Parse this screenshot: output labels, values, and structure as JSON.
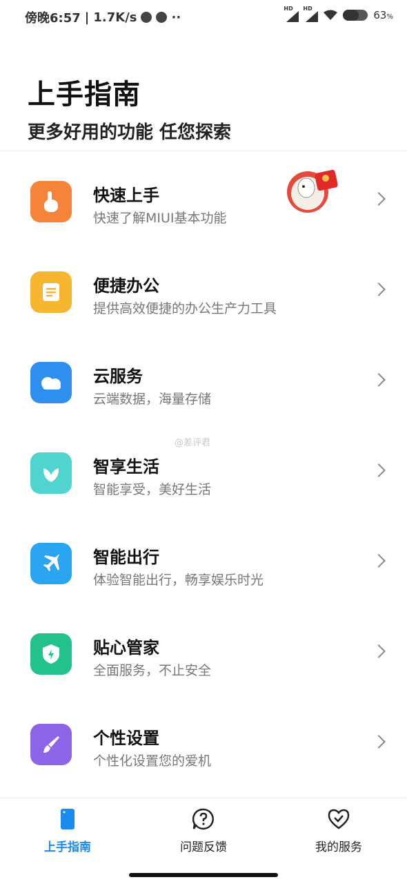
{
  "status_bar": {
    "time": "傍晚6:57",
    "speed": "1.7K/s",
    "battery": "63",
    "battery_unit": "%",
    "hd1": "HD",
    "hd2": "HD"
  },
  "header": {
    "title": "上手指南",
    "subtitle": "更多好用的功能 任您探索"
  },
  "items": [
    {
      "title": "快速上手",
      "desc": "快速了解MIUI基本功能",
      "icon": "hand-tap-icon",
      "color": "#f5833a"
    },
    {
      "title": "便捷办公",
      "desc": "提供高效便捷的办公生产力工具",
      "icon": "document-icon",
      "color": "#f7b62f"
    },
    {
      "title": "云服务",
      "desc": "云端数据，海量存储",
      "icon": "cloud-icon",
      "color": "#2f8ff0"
    },
    {
      "title": "智享生活",
      "desc": "智能享受，美好生活",
      "icon": "leaf-icon",
      "color": "#4fd4cf"
    },
    {
      "title": "智能出行",
      "desc": "体验智能出行，畅享娱乐时光",
      "icon": "airplane-icon",
      "color": "#2aa5f2"
    },
    {
      "title": "贴心管家",
      "desc": "全面服务，不止安全",
      "icon": "shield-icon",
      "color": "#22c28a"
    },
    {
      "title": "个性设置",
      "desc": "个性化设置您的爱机",
      "icon": "brush-icon",
      "color": "#8d63e8"
    }
  ],
  "watermark": "@差评君",
  "bottom_nav": {
    "tabs": [
      {
        "label": "上手指南",
        "icon": "phone-icon",
        "active": true
      },
      {
        "label": "问题反馈",
        "icon": "question-icon",
        "active": false
      },
      {
        "label": "我的服务",
        "icon": "heart-check-icon",
        "active": false
      }
    ]
  },
  "colors": {
    "accent": "#1a8cf0"
  }
}
